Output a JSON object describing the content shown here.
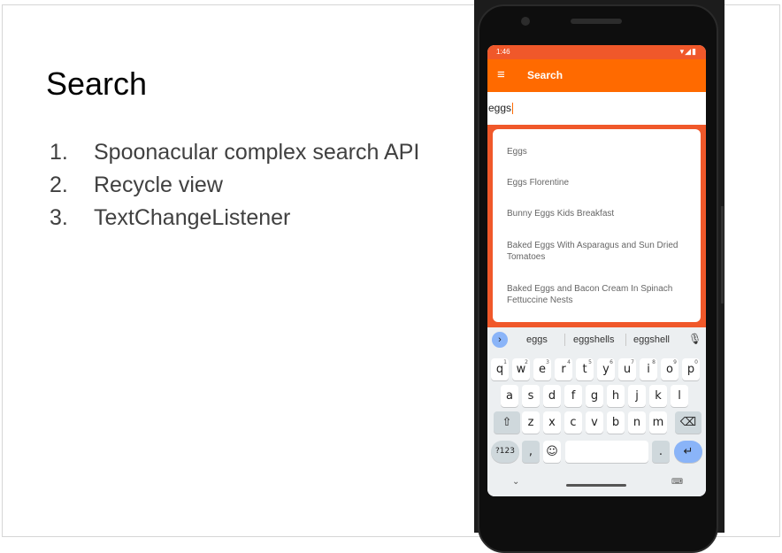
{
  "slide": {
    "title": "Search",
    "bullets": [
      {
        "num": "1.",
        "text": "Spoonacular complex search API"
      },
      {
        "num": "2.",
        "text": "Recycle view"
      },
      {
        "num": "3.",
        "text": "TextChangeListener"
      }
    ]
  },
  "phone": {
    "status": {
      "time": "1:46",
      "icons": "▾◢▮"
    },
    "appbar": {
      "menu_glyph": "≡",
      "title": "Search"
    },
    "search": {
      "value": "eggs"
    },
    "results": [
      "Eggs",
      "Eggs Florentine",
      "Bunny Eggs Kids Breakfast",
      "Baked Eggs With Asparagus and Sun Dried Tomatoes",
      "Baked Eggs and Bacon Cream In Spinach Fettuccine Nests"
    ],
    "keyboard": {
      "suggestions": [
        "eggs",
        "eggshells",
        "eggshell"
      ],
      "row1": [
        {
          "k": "q",
          "n": "1"
        },
        {
          "k": "w",
          "n": "2"
        },
        {
          "k": "e",
          "n": "3"
        },
        {
          "k": "r",
          "n": "4"
        },
        {
          "k": "t",
          "n": "5"
        },
        {
          "k": "y",
          "n": "6"
        },
        {
          "k": "u",
          "n": "7"
        },
        {
          "k": "i",
          "n": "8"
        },
        {
          "k": "o",
          "n": "9"
        },
        {
          "k": "p",
          "n": "0"
        }
      ],
      "row2": [
        "a",
        "s",
        "d",
        "f",
        "g",
        "h",
        "j",
        "k",
        "l"
      ],
      "row3": [
        "z",
        "x",
        "c",
        "v",
        "b",
        "n",
        "m"
      ],
      "shift": "⇧",
      "backspace": "⌫",
      "numbers_label": "?123",
      "comma": ",",
      "emoji": "☺",
      "period": ".",
      "enter": "↵",
      "mic": "🎙",
      "nav_back": "⌄",
      "nav_keyboard": "⌨"
    }
  }
}
